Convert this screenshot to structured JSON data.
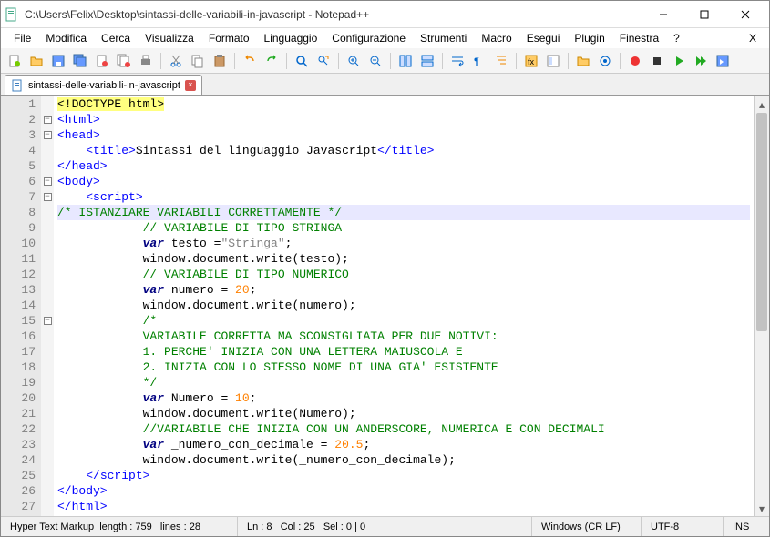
{
  "titlebar": {
    "path": "C:\\Users\\Felix\\Desktop\\sintassi-delle-variabili-in-javascript - Notepad++"
  },
  "menu": {
    "items": [
      "File",
      "Modifica",
      "Cerca",
      "Visualizza",
      "Formato",
      "Linguaggio",
      "Configurazione",
      "Strumenti",
      "Macro",
      "Esegui",
      "Plugin",
      "Finestra",
      "?"
    ],
    "rightX": "X"
  },
  "tab": {
    "name": "sintassi-delle-variabili-in-javascript"
  },
  "code": {
    "lines": [
      {
        "n": 1,
        "fold": "",
        "tokens": [
          {
            "c": "c-doctype",
            "t": "<!DOCTYPE html>"
          }
        ]
      },
      {
        "n": 2,
        "fold": "minus",
        "tokens": [
          {
            "c": "c-tag",
            "t": "<html>"
          }
        ]
      },
      {
        "n": 3,
        "fold": "minus",
        "tokens": [
          {
            "c": "c-tag",
            "t": "<head>"
          }
        ]
      },
      {
        "n": 4,
        "fold": "",
        "tokens": [
          {
            "c": "",
            "t": "    "
          },
          {
            "c": "c-tag",
            "t": "<title>"
          },
          {
            "c": "",
            "t": "Sintassi del linguaggio Javascript"
          },
          {
            "c": "c-tag",
            "t": "</title>"
          }
        ]
      },
      {
        "n": 5,
        "fold": "",
        "tokens": [
          {
            "c": "c-tag",
            "t": "</head>"
          }
        ]
      },
      {
        "n": 6,
        "fold": "minus",
        "tokens": [
          {
            "c": "c-tag",
            "t": "<body>"
          }
        ]
      },
      {
        "n": 7,
        "fold": "minus",
        "tokens": [
          {
            "c": "",
            "t": "    "
          },
          {
            "c": "c-tag",
            "t": "<script>"
          }
        ]
      },
      {
        "n": 8,
        "fold": "",
        "hl": true,
        "tokens": [
          {
            "c": "c-cmt",
            "t": "/* ISTANZIARE VARIABILI CORRETTAMENTE */"
          }
        ]
      },
      {
        "n": 9,
        "fold": "",
        "tokens": [
          {
            "c": "",
            "t": "            "
          },
          {
            "c": "c-cmt",
            "t": "// VARIABILE DI TIPO STRINGA"
          }
        ]
      },
      {
        "n": 10,
        "fold": "",
        "tokens": [
          {
            "c": "",
            "t": "            "
          },
          {
            "c": "c-kw2",
            "t": "var"
          },
          {
            "c": "",
            "t": " testo ="
          },
          {
            "c": "c-str",
            "t": "\"Stringa\""
          },
          {
            "c": "",
            "t": ";"
          }
        ]
      },
      {
        "n": 11,
        "fold": "",
        "tokens": [
          {
            "c": "",
            "t": "            window.document.write(testo);"
          }
        ]
      },
      {
        "n": 12,
        "fold": "",
        "tokens": [
          {
            "c": "",
            "t": "            "
          },
          {
            "c": "c-cmt",
            "t": "// VARIABILE DI TIPO NUMERICO"
          }
        ]
      },
      {
        "n": 13,
        "fold": "",
        "tokens": [
          {
            "c": "",
            "t": "            "
          },
          {
            "c": "c-kw2",
            "t": "var"
          },
          {
            "c": "",
            "t": " numero = "
          },
          {
            "c": "c-num",
            "t": "20"
          },
          {
            "c": "",
            "t": ";"
          }
        ]
      },
      {
        "n": 14,
        "fold": "",
        "tokens": [
          {
            "c": "",
            "t": "            window.document.write(numero);"
          }
        ]
      },
      {
        "n": 15,
        "fold": "minus",
        "tokens": [
          {
            "c": "",
            "t": "            "
          },
          {
            "c": "c-cmt",
            "t": "/*"
          }
        ]
      },
      {
        "n": 16,
        "fold": "",
        "tokens": [
          {
            "c": "",
            "t": "            "
          },
          {
            "c": "c-cmt",
            "t": "VARIABILE CORRETTA MA SCONSIGLIATA PER DUE NOTIVI:"
          }
        ]
      },
      {
        "n": 17,
        "fold": "",
        "tokens": [
          {
            "c": "",
            "t": "            "
          },
          {
            "c": "c-cmt",
            "t": "1. PERCHE' INIZIA CON UNA LETTERA MAIUSCOLA E"
          }
        ]
      },
      {
        "n": 18,
        "fold": "",
        "tokens": [
          {
            "c": "",
            "t": "            "
          },
          {
            "c": "c-cmt",
            "t": "2. INIZIA CON LO STESSO NOME DI UNA GIA' ESISTENTE"
          }
        ]
      },
      {
        "n": 19,
        "fold": "",
        "tokens": [
          {
            "c": "",
            "t": "            "
          },
          {
            "c": "c-cmt",
            "t": "*/"
          }
        ]
      },
      {
        "n": 20,
        "fold": "",
        "tokens": [
          {
            "c": "",
            "t": "            "
          },
          {
            "c": "c-kw2",
            "t": "var"
          },
          {
            "c": "",
            "t": " Numero = "
          },
          {
            "c": "c-num",
            "t": "10"
          },
          {
            "c": "",
            "t": ";"
          }
        ]
      },
      {
        "n": 21,
        "fold": "",
        "tokens": [
          {
            "c": "",
            "t": "            window.document.write(Numero);"
          }
        ]
      },
      {
        "n": 22,
        "fold": "",
        "tokens": [
          {
            "c": "",
            "t": "            "
          },
          {
            "c": "c-cmt",
            "t": "//VARIABILE CHE INIZIA CON UN ANDERSCORE, NUMERICA E CON DECIMALI"
          }
        ]
      },
      {
        "n": 23,
        "fold": "",
        "tokens": [
          {
            "c": "",
            "t": "            "
          },
          {
            "c": "c-kw2",
            "t": "var"
          },
          {
            "c": "",
            "t": " _numero_con_decimale = "
          },
          {
            "c": "c-num",
            "t": "20.5"
          },
          {
            "c": "",
            "t": ";"
          }
        ]
      },
      {
        "n": 24,
        "fold": "",
        "tokens": [
          {
            "c": "",
            "t": "            window.document.write(_numero_con_decimale);"
          }
        ]
      },
      {
        "n": 25,
        "fold": "",
        "tokens": [
          {
            "c": "",
            "t": "    "
          },
          {
            "c": "c-tag",
            "t": "</script>"
          }
        ]
      },
      {
        "n": 26,
        "fold": "",
        "tokens": [
          {
            "c": "c-tag",
            "t": "</body>"
          }
        ]
      },
      {
        "n": 27,
        "fold": "",
        "tokens": [
          {
            "c": "c-tag",
            "t": "</html>"
          }
        ]
      }
    ]
  },
  "status": {
    "lang": "Hyper Text Markup",
    "length_label": "length :",
    "length": "759",
    "lines_label": "lines :",
    "lines": "28",
    "ln_label": "Ln :",
    "ln": "8",
    "col_label": "Col :",
    "col": "25",
    "sel_label": "Sel :",
    "sel": "0 | 0",
    "eol": "Windows (CR LF)",
    "encoding": "UTF-8",
    "mode": "INS"
  },
  "toolbar_icons": [
    "new-file-icon",
    "open-file-icon",
    "save-icon",
    "save-all-icon",
    "close-icon",
    "close-all-icon",
    "print-icon",
    "sep",
    "cut-icon",
    "copy-icon",
    "paste-icon",
    "sep",
    "undo-icon",
    "redo-icon",
    "sep",
    "find-icon",
    "replace-icon",
    "sep",
    "zoom-in-icon",
    "zoom-out-icon",
    "sep",
    "sync-v-icon",
    "sync-h-icon",
    "sep",
    "wordwrap-icon",
    "allchars-icon",
    "indent-guide-icon",
    "sep",
    "lang-icon",
    "doc-map-icon",
    "sep",
    "folder-icon",
    "monitor-icon",
    "sep",
    "record-icon",
    "stop-icon",
    "play-icon",
    "play-multi-icon",
    "save-macro-icon"
  ]
}
